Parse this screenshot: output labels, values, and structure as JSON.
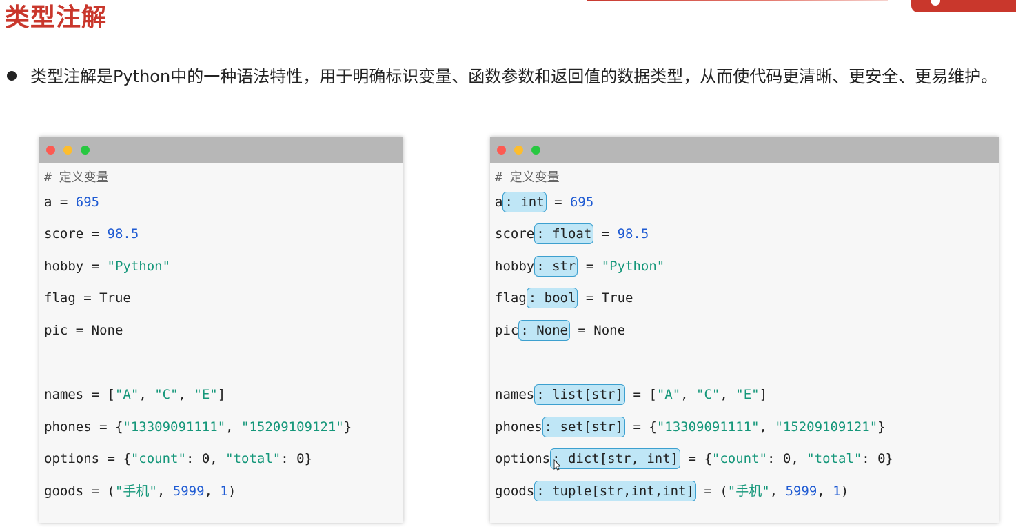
{
  "heading": "类型注解",
  "intro": "类型注解是Python中的一种语法特性，用于明确标识变量、函数参数和返回值的数据类型，从而使代码更清晰、更安全、更易维护。",
  "colors": {
    "accent": "#c9372c",
    "number": "#1f5bd3",
    "string": "#15977a",
    "annotation_bg": "#bfe6f6"
  },
  "left_code": {
    "comment": "# 定义变量",
    "a": {
      "name": "a",
      "eq": " = ",
      "val": "695"
    },
    "score": {
      "name": "score",
      "eq": " = ",
      "val": "98.5"
    },
    "hobby": {
      "name": "hobby",
      "eq": " = ",
      "val": "\"Python\""
    },
    "flag": {
      "name": "flag",
      "eq": " = ",
      "val": "True"
    },
    "pic": {
      "name": "pic",
      "eq": " = ",
      "val": "None"
    },
    "names": {
      "name": "names",
      "eq": " = ",
      "open": "[",
      "s1": "\"A\"",
      "c1": ", ",
      "s2": "\"C\"",
      "c2": ", ",
      "s3": "\"E\"",
      "close": "]"
    },
    "phones": {
      "name": "phones",
      "eq": " = ",
      "open": "{",
      "s1": "\"13309091111\"",
      "c1": ", ",
      "s2": "\"15209109121\"",
      "close": "}"
    },
    "options": {
      "name": "options",
      "eq": " = ",
      "open": "{",
      "k1": "\"count\"",
      "colon1": ": ",
      "v1": "0",
      "c1": ", ",
      "k2": "\"total\"",
      "colon2": ": ",
      "v2": "0",
      "close": "}"
    },
    "goods": {
      "name": "goods",
      "eq": " = ",
      "open": "(",
      "s1": "\"手机\"",
      "c1": ", ",
      "n1": "5999",
      "c2": ", ",
      "n2": "1",
      "close": ")"
    }
  },
  "right_code": {
    "comment": "# 定义变量",
    "a": {
      "name": "a",
      "ann": ": int",
      "eq": " = ",
      "val": "695"
    },
    "score": {
      "name": "score",
      "ann": ": float",
      "eq": " = ",
      "val": "98.5"
    },
    "hobby": {
      "name": "hobby",
      "ann": ": str",
      "eq": " = ",
      "val": "\"Python\""
    },
    "flag": {
      "name": "flag",
      "ann": ": bool",
      "eq": " = ",
      "val": "True"
    },
    "pic": {
      "name": "pic",
      "ann": ": None",
      "eq": " = ",
      "val": "None"
    },
    "names": {
      "name": "names",
      "ann": ": list[str]",
      "eq": " = ",
      "open": "[",
      "s1": "\"A\"",
      "c1": ", ",
      "s2": "\"C\"",
      "c2": ", ",
      "s3": "\"E\"",
      "close": "]"
    },
    "phones": {
      "name": "phones",
      "ann": ": set[str]",
      "eq": " = ",
      "open": "{",
      "s1": "\"13309091111\"",
      "c1": ", ",
      "s2": "\"15209109121\"",
      "close": "}"
    },
    "options": {
      "name": "options",
      "ann": ": dict[str, int]",
      "eq": " = ",
      "open": "{",
      "k1": "\"count\"",
      "colon1": ": ",
      "v1": "0",
      "c1": ", ",
      "k2": "\"total\"",
      "colon2": ": ",
      "v2": "0",
      "close": "}"
    },
    "goods": {
      "name": "goods",
      "ann": ": tuple[str,int,int]",
      "eq": " = ",
      "open": "(",
      "s1": "\"手机\"",
      "c1": ", ",
      "n1": "5999",
      "c2": ", ",
      "n2": "1",
      "close": ")"
    }
  }
}
